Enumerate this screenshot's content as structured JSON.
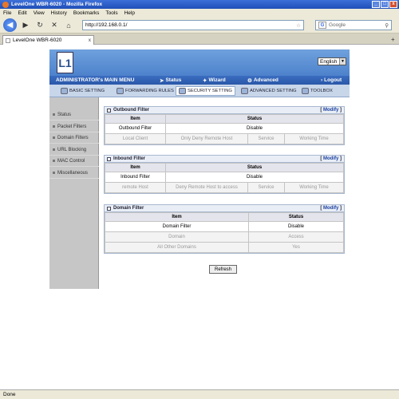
{
  "window": {
    "title": "LevelOne WBR-6020 - Mozilla Firefox",
    "min": "_",
    "max": "□",
    "close": "x"
  },
  "menu": [
    "File",
    "Edit",
    "View",
    "History",
    "Bookmarks",
    "Tools",
    "Help"
  ],
  "nav": {
    "url": "http://192.168.0.1/",
    "search_placeholder": "Google",
    "search_logo": "G"
  },
  "tab": {
    "title": "LevelOne WBR-6020",
    "close": "x",
    "new": "+"
  },
  "status_text": "Done",
  "router": {
    "logo_text": "L1",
    "language": "English",
    "menu_title": "ADMINISTRATOR's MAIN MENU",
    "menu_items": [
      "Status",
      "Wizard",
      "Advanced",
      "Logout"
    ],
    "subtabs": [
      "BASIC SETTING",
      "FORWARDING RULES",
      "SECURITY SETTING",
      "ADVANCED SETTING",
      "TOOLBOX"
    ],
    "sidebar": [
      "Status",
      "Packet Filters",
      "Domain Filters",
      "URL Blocking",
      "MAC Control",
      "Miscellaneous"
    ],
    "outbound": {
      "title": "Outbound Filter",
      "modify": "Modify",
      "col_item": "Item",
      "col_status": "Status",
      "row_label": "Outbound Filter",
      "row_value": "Disable",
      "sub": [
        "Local Client",
        "Only Deny Remote Host",
        "Service",
        "Working Time"
      ]
    },
    "inbound": {
      "title": "Inbound Filter",
      "modify": "Modify",
      "col_item": "Item",
      "col_status": "Status",
      "row_label": "Inbound Filter",
      "row_value": "Disable",
      "sub": [
        "remote Host",
        "Deny Remote Host to access",
        "Service",
        "Working Time"
      ]
    },
    "domain": {
      "title": "Domain Filter",
      "modify": "Modify",
      "col_item": "Item",
      "col_status": "Status",
      "row_label": "Domain Filter",
      "row_value": "Disable",
      "sub_domain": "Domain",
      "sub_access": "Access",
      "other_domains": "All Other Domains",
      "other_access": "Yes"
    },
    "refresh_label": "Refresh"
  }
}
